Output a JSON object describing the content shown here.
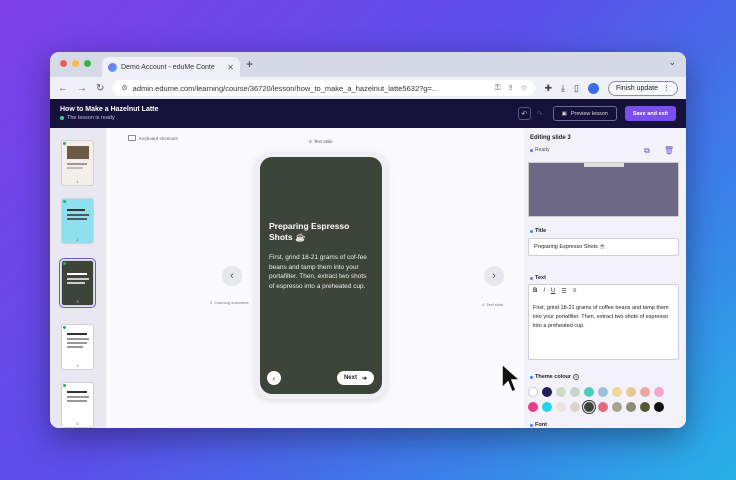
{
  "browser": {
    "tab_title": "Demo Account - eduMe Conte",
    "url": "admin.edume.com/learning/course/36720/lesson/how_to_make_a_hazelnut_latte5632?g=...",
    "finish_update": "Finish update",
    "traffic_colors": [
      "#ee5c55",
      "#f5bd42",
      "#3bb24a"
    ]
  },
  "header": {
    "title": "How to Make a Hazelnut Latte",
    "status": "The lesson is ready",
    "preview_label": "Preview lesson",
    "save_label": "Save and exit"
  },
  "thumbnails": [
    {
      "num": "1"
    },
    {
      "num": "2"
    },
    {
      "num": "3"
    },
    {
      "num": "4"
    },
    {
      "num": "5"
    }
  ],
  "canvas": {
    "keyboard_shortcuts": "Keyboard shortcuts",
    "slide_label": "3. Text slide",
    "prev_label": "2. Learning outcomes",
    "next_label": "4. Text slide",
    "slide_title": "Preparing Espresso Shots ☕",
    "slide_text": "First, grind 18-21 grams of cof-fee beans and tamp them into your portafilter. Then, extract two shots of espresso into a preheated cup.",
    "next_button": "Next"
  },
  "panel": {
    "title": "Editing slide 3",
    "ready": "Ready",
    "title_label": "Title",
    "title_value": "Preparing Espresso Shots ☕",
    "text_label": "Text",
    "text_value": "First, grind 18-21 grams of coffee beans and tamp them into your portafilter. Then, extract two shots of espresso into a preheated cup.",
    "theme_label": "Theme colour",
    "font_label": "Font",
    "swatches_row1": [
      "#ffffff",
      "#1f1f5a",
      "#cfd9c6",
      "#c9d4cd",
      "#4dcbc1",
      "#9dc0d8",
      "#efd89c",
      "#e9c79a",
      "#f0a79f",
      "#f4a7c9"
    ],
    "swatches_row2": [
      "#e73e8e",
      "#21d4e8",
      "#e9e5dd",
      "#d9d6c9",
      "#3d4438",
      "#e2697f",
      "#a8a393",
      "#8d8a7a",
      "#575a30",
      "#111111"
    ]
  }
}
